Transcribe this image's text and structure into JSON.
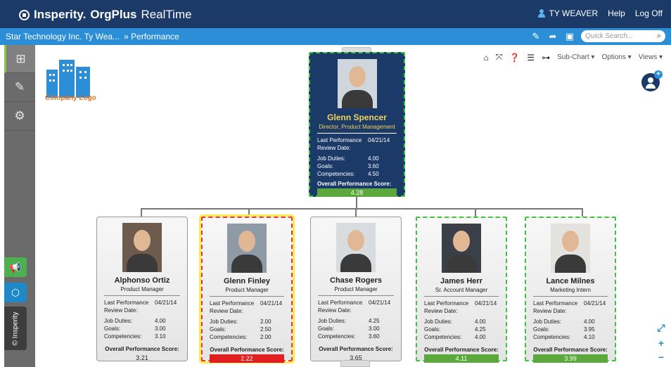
{
  "app": {
    "brand": "Insperity.",
    "product": "OrgPlus",
    "edition": "RealTime",
    "user": "TY WEAVER",
    "help": "Help",
    "logoff": "Log Off"
  },
  "breadcrumb": {
    "company": "Star Technology Inc. Ty Wea...",
    "current": "» Performance",
    "search_placeholder": "Quick Search..."
  },
  "toolbar": {
    "subchart": "Sub-Chart ▾",
    "options": "Options ▾",
    "views": "Views ▾"
  },
  "company_logo": {
    "text": "Company Logo"
  },
  "sidebar": {
    "vertical_label": "© Insperity"
  },
  "labels": {
    "last_review": "Last Performance Review Date:",
    "job_duties": "Job Duties:",
    "goals": "Goals:",
    "competencies": "Competencies:",
    "overall": "Overall Performance Score:"
  },
  "manager": {
    "name": "Glenn Spencer",
    "title": "Director, Product Management",
    "review_date": "04/21/14",
    "job_duties": "4.00",
    "goals": "3.60",
    "competencies": "4.50",
    "overall": "4.28"
  },
  "reports": [
    {
      "name": "Alphonso Ortiz",
      "title": "Product Manager",
      "review_date": "04/21/14",
      "job_duties": "4.00",
      "goals": "3.00",
      "competencies": "3.10",
      "overall": "3.21",
      "status": "neutral"
    },
    {
      "name": "Glenn Finley",
      "title": "Product Manager",
      "review_date": "04/21/14",
      "job_duties": "2.00",
      "goals": "2.50",
      "competencies": "2.00",
      "overall": "2.22",
      "status": "red"
    },
    {
      "name": "Chase Rogers",
      "title": "Product Manager",
      "review_date": "04/21/14",
      "job_duties": "4.25",
      "goals": "3.00",
      "competencies": "3.60",
      "overall": "3.65",
      "status": "neutral"
    },
    {
      "name": "James Herr",
      "title": "Sr. Account Manager",
      "review_date": "04/21/14",
      "job_duties": "4.00",
      "goals": "4.25",
      "competencies": "4.00",
      "overall": "4.11",
      "status": "green"
    },
    {
      "name": "Lance Milnes",
      "title": "Marketing Intern",
      "review_date": "04/21/14",
      "job_duties": "4.00",
      "goals": "3.95",
      "competencies": "4.10",
      "overall": "3.99",
      "status": "green"
    }
  ]
}
